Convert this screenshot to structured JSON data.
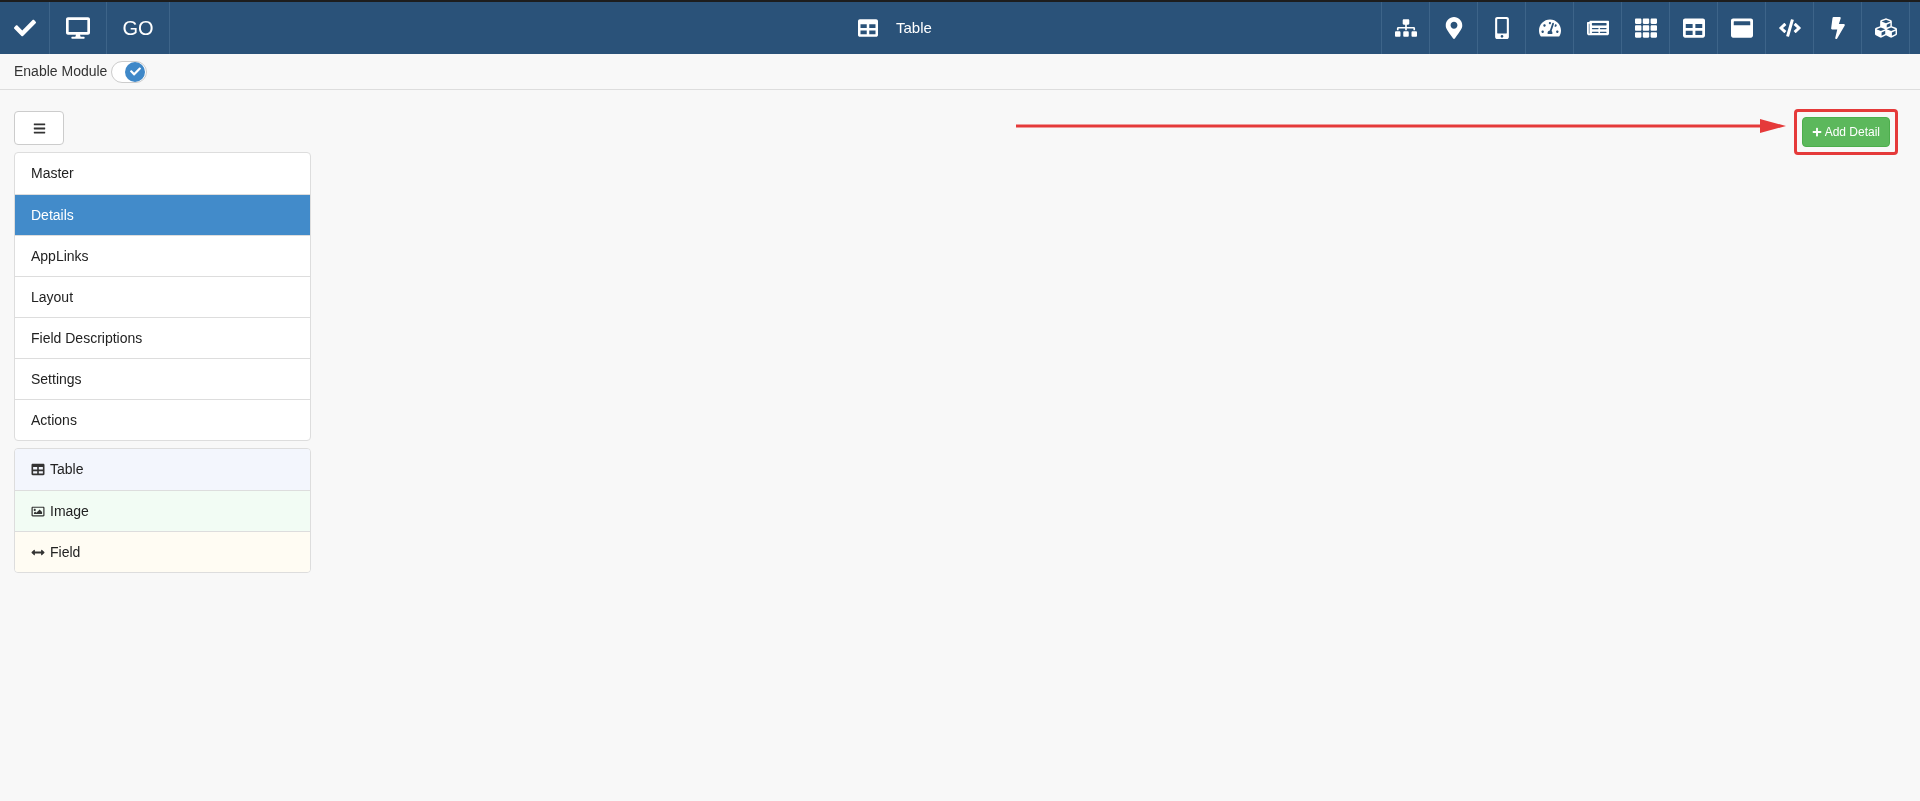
{
  "header": {
    "go_label": "GO",
    "title": "Table"
  },
  "module_toggle": {
    "label": "Enable Module",
    "on": true
  },
  "menu": {
    "items": [
      {
        "label": "Master",
        "selected": false
      },
      {
        "label": "Details",
        "selected": true
      },
      {
        "label": "AppLinks",
        "selected": false
      },
      {
        "label": "Layout",
        "selected": false
      },
      {
        "label": "Field Descriptions",
        "selected": false
      },
      {
        "label": "Settings",
        "selected": false
      },
      {
        "label": "Actions",
        "selected": false
      }
    ]
  },
  "detail_types": [
    {
      "label": "Table",
      "kind": "table"
    },
    {
      "label": "Image",
      "kind": "image"
    },
    {
      "label": "Field",
      "kind": "field"
    }
  ],
  "add_button": {
    "label": "Add Detail"
  }
}
